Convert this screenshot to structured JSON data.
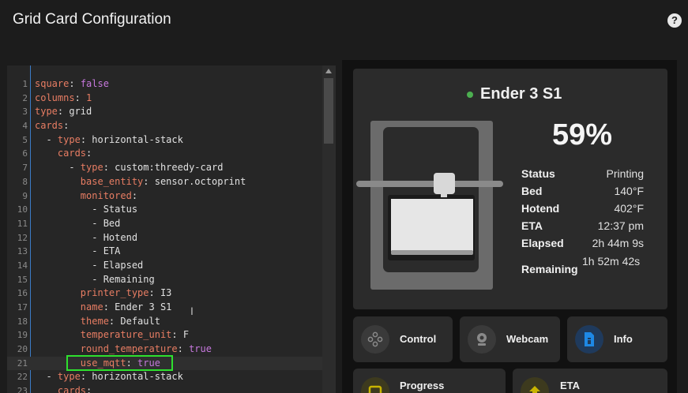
{
  "dialog": {
    "title": "Grid Card Configuration",
    "help_icon": "help-icon"
  },
  "editor": {
    "lines": [
      {
        "n": "1",
        "indent": "",
        "key": "square",
        "sep": ": ",
        "val": "false",
        "cls": "b"
      },
      {
        "n": "2",
        "indent": "",
        "key": "columns",
        "sep": ": ",
        "val": "1",
        "cls": "n"
      },
      {
        "n": "3",
        "indent": "",
        "key": "type",
        "sep": ": ",
        "val": "grid",
        "cls": "v"
      },
      {
        "n": "4",
        "indent": "",
        "key": "cards",
        "sep": ":",
        "val": "",
        "cls": "v"
      },
      {
        "n": "5",
        "indent": "  - ",
        "key": "type",
        "sep": ": ",
        "val": "horizontal-stack",
        "cls": "v"
      },
      {
        "n": "6",
        "indent": "    ",
        "key": "cards",
        "sep": ":",
        "val": "",
        "cls": "v"
      },
      {
        "n": "7",
        "indent": "      - ",
        "key": "type",
        "sep": ": ",
        "val": "custom:threedy-card",
        "cls": "v"
      },
      {
        "n": "8",
        "indent": "        ",
        "key": "base_entity",
        "sep": ": ",
        "val": "sensor.octoprint",
        "cls": "v"
      },
      {
        "n": "9",
        "indent": "        ",
        "key": "monitored",
        "sep": ":",
        "val": "",
        "cls": "v"
      },
      {
        "n": "10",
        "indent": "          - ",
        "key": "",
        "sep": "",
        "val": "Status",
        "cls": "v"
      },
      {
        "n": "11",
        "indent": "          - ",
        "key": "",
        "sep": "",
        "val": "Bed",
        "cls": "v"
      },
      {
        "n": "12",
        "indent": "          - ",
        "key": "",
        "sep": "",
        "val": "Hotend",
        "cls": "v"
      },
      {
        "n": "13",
        "indent": "          - ",
        "key": "",
        "sep": "",
        "val": "ETA",
        "cls": "v"
      },
      {
        "n": "14",
        "indent": "          - ",
        "key": "",
        "sep": "",
        "val": "Elapsed",
        "cls": "v"
      },
      {
        "n": "15",
        "indent": "          - ",
        "key": "",
        "sep": "",
        "val": "Remaining",
        "cls": "v"
      },
      {
        "n": "16",
        "indent": "        ",
        "key": "printer_type",
        "sep": ": ",
        "val": "I3",
        "cls": "v"
      },
      {
        "n": "17",
        "indent": "        ",
        "key": "name",
        "sep": ": ",
        "val": "Ender 3 S1",
        "cls": "v"
      },
      {
        "n": "18",
        "indent": "        ",
        "key": "theme",
        "sep": ": ",
        "val": "Default",
        "cls": "v"
      },
      {
        "n": "19",
        "indent": "        ",
        "key": "temperature_unit",
        "sep": ": ",
        "val": "F",
        "cls": "v"
      },
      {
        "n": "20",
        "indent": "        ",
        "key": "round_temperature",
        "sep": ": ",
        "val": "true",
        "cls": "b"
      },
      {
        "n": "21",
        "indent": "        ",
        "key": "use_mqtt",
        "sep": ": ",
        "val": "true",
        "cls": "b"
      },
      {
        "n": "22",
        "indent": "  - ",
        "key": "type",
        "sep": ": ",
        "val": "horizontal-stack",
        "cls": "v"
      },
      {
        "n": "23",
        "indent": "    ",
        "key": "cards",
        "sep": ":",
        "val": "",
        "cls": "v"
      }
    ],
    "active_line": "21"
  },
  "card": {
    "name": "Ender 3 S1",
    "progress": "59%",
    "stats": [
      {
        "label": "Status",
        "value": "Printing"
      },
      {
        "label": "Bed",
        "value": "140°F"
      },
      {
        "label": "Hotend",
        "value": "402°F"
      },
      {
        "label": "ETA",
        "value": "12:37 pm"
      },
      {
        "label": "Elapsed",
        "value": "2h 44m 9s"
      },
      {
        "label": "Remaining",
        "value": "1h 52m 42s"
      }
    ],
    "status_color": "#4caf50"
  },
  "buttons": {
    "control": {
      "label": "Control",
      "icon": "gamepad-icon"
    },
    "webcam": {
      "label": "Webcam",
      "icon": "webcam-icon"
    },
    "info": {
      "label": "Info",
      "icon": "info-file-icon",
      "accent": "#1e88e5"
    },
    "progress": {
      "label": "Progress",
      "icon": "printer-icon",
      "accent": "#c8b400"
    },
    "eta": {
      "label": "ETA",
      "icon": "clock-icon",
      "accent": "#c8b400"
    }
  }
}
